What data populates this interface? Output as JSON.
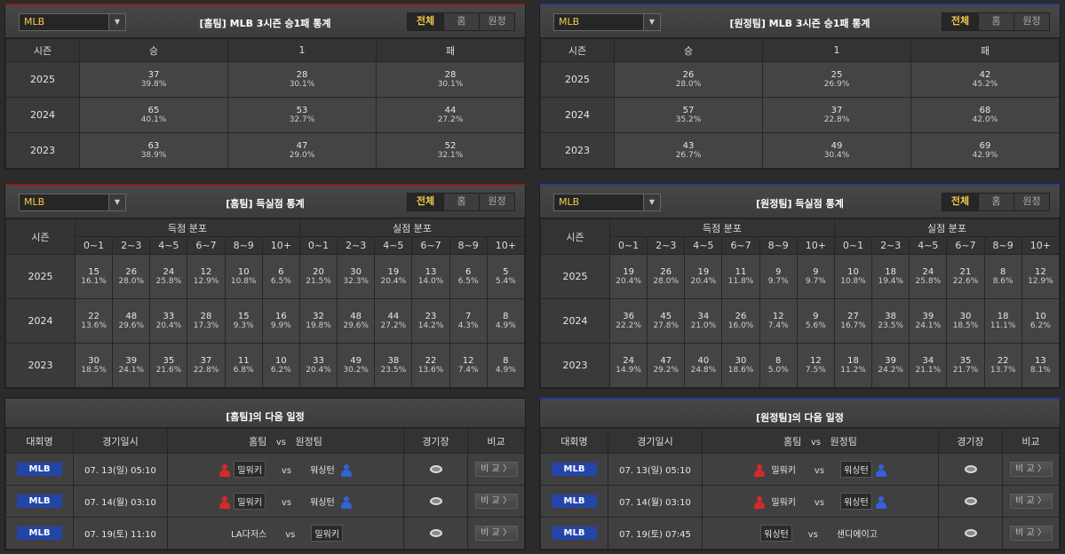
{
  "colors": {
    "home_accent": "#8b1e1e",
    "away_accent": "#23408a",
    "active_tab": "#f2c94c",
    "league_badge": "#2445a8"
  },
  "record": {
    "home": {
      "title": "[홈팀] MLB 3시즌 승1패 통계"
    },
    "away": {
      "title": "[원정팀] MLB 3시즌 승1패 통계"
    },
    "selector": "MLB",
    "tabs": [
      "전체",
      "홈",
      "원정"
    ],
    "headers": [
      "시즌",
      "승",
      "1",
      "패"
    ],
    "home_rows": [
      {
        "season": "2025",
        "cells": [
          [
            "37",
            "39.8%"
          ],
          [
            "28",
            "30.1%"
          ],
          [
            "28",
            "30.1%"
          ]
        ]
      },
      {
        "season": "2024",
        "cells": [
          [
            "65",
            "40.1%"
          ],
          [
            "53",
            "32.7%"
          ],
          [
            "44",
            "27.2%"
          ]
        ]
      },
      {
        "season": "2023",
        "cells": [
          [
            "63",
            "38.9%"
          ],
          [
            "47",
            "29.0%"
          ],
          [
            "52",
            "32.1%"
          ]
        ]
      }
    ],
    "away_rows": [
      {
        "season": "2025",
        "cells": [
          [
            "26",
            "28.0%"
          ],
          [
            "25",
            "26.9%"
          ],
          [
            "42",
            "45.2%"
          ]
        ]
      },
      {
        "season": "2024",
        "cells": [
          [
            "57",
            "35.2%"
          ],
          [
            "37",
            "22.8%"
          ],
          [
            "68",
            "42.0%"
          ]
        ]
      },
      {
        "season": "2023",
        "cells": [
          [
            "43",
            "26.7%"
          ],
          [
            "49",
            "30.4%"
          ],
          [
            "69",
            "42.9%"
          ]
        ]
      }
    ]
  },
  "scoring": {
    "home": {
      "title": "[홈팀] 득실점 통계"
    },
    "away": {
      "title": "[원정팀] 득실점 통계"
    },
    "season_header": "시즌",
    "scored_header": "득점 분포",
    "conceded_header": "실점 분포",
    "bins": [
      "0~1",
      "2~3",
      "4~5",
      "6~7",
      "8~9",
      "10+"
    ],
    "home_rows": [
      {
        "season": "2025",
        "cells": [
          [
            "15",
            "16.1%"
          ],
          [
            "26",
            "28.0%"
          ],
          [
            "24",
            "25.8%"
          ],
          [
            "12",
            "12.9%"
          ],
          [
            "10",
            "10.8%"
          ],
          [
            "6",
            "6.5%"
          ],
          [
            "20",
            "21.5%"
          ],
          [
            "30",
            "32.3%"
          ],
          [
            "19",
            "20.4%"
          ],
          [
            "13",
            "14.0%"
          ],
          [
            "6",
            "6.5%"
          ],
          [
            "5",
            "5.4%"
          ]
        ]
      },
      {
        "season": "2024",
        "cells": [
          [
            "22",
            "13.6%"
          ],
          [
            "48",
            "29.6%"
          ],
          [
            "33",
            "20.4%"
          ],
          [
            "28",
            "17.3%"
          ],
          [
            "15",
            "9.3%"
          ],
          [
            "16",
            "9.9%"
          ],
          [
            "32",
            "19.8%"
          ],
          [
            "48",
            "29.6%"
          ],
          [
            "44",
            "27.2%"
          ],
          [
            "23",
            "14.2%"
          ],
          [
            "7",
            "4.3%"
          ],
          [
            "8",
            "4.9%"
          ]
        ]
      },
      {
        "season": "2023",
        "cells": [
          [
            "30",
            "18.5%"
          ],
          [
            "39",
            "24.1%"
          ],
          [
            "35",
            "21.6%"
          ],
          [
            "37",
            "22.8%"
          ],
          [
            "11",
            "6.8%"
          ],
          [
            "10",
            "6.2%"
          ],
          [
            "33",
            "20.4%"
          ],
          [
            "49",
            "30.2%"
          ],
          [
            "38",
            "23.5%"
          ],
          [
            "22",
            "13.6%"
          ],
          [
            "12",
            "7.4%"
          ],
          [
            "8",
            "4.9%"
          ]
        ]
      }
    ],
    "away_rows": [
      {
        "season": "2025",
        "cells": [
          [
            "19",
            "20.4%"
          ],
          [
            "26",
            "28.0%"
          ],
          [
            "19",
            "20.4%"
          ],
          [
            "11",
            "11.8%"
          ],
          [
            "9",
            "9.7%"
          ],
          [
            "9",
            "9.7%"
          ],
          [
            "10",
            "10.8%"
          ],
          [
            "18",
            "19.4%"
          ],
          [
            "24",
            "25.8%"
          ],
          [
            "21",
            "22.6%"
          ],
          [
            "8",
            "8.6%"
          ],
          [
            "12",
            "12.9%"
          ]
        ]
      },
      {
        "season": "2024",
        "cells": [
          [
            "36",
            "22.2%"
          ],
          [
            "45",
            "27.8%"
          ],
          [
            "34",
            "21.0%"
          ],
          [
            "26",
            "16.0%"
          ],
          [
            "12",
            "7.4%"
          ],
          [
            "9",
            "5.6%"
          ],
          [
            "27",
            "16.7%"
          ],
          [
            "38",
            "23.5%"
          ],
          [
            "39",
            "24.1%"
          ],
          [
            "30",
            "18.5%"
          ],
          [
            "18",
            "11.1%"
          ],
          [
            "10",
            "6.2%"
          ]
        ]
      },
      {
        "season": "2023",
        "cells": [
          [
            "24",
            "14.9%"
          ],
          [
            "47",
            "29.2%"
          ],
          [
            "40",
            "24.8%"
          ],
          [
            "30",
            "18.6%"
          ],
          [
            "8",
            "5.0%"
          ],
          [
            "12",
            "7.5%"
          ],
          [
            "18",
            "11.2%"
          ],
          [
            "39",
            "24.2%"
          ],
          [
            "34",
            "21.1%"
          ],
          [
            "35",
            "21.7%"
          ],
          [
            "22",
            "13.7%"
          ],
          [
            "13",
            "8.1%"
          ]
        ]
      }
    ]
  },
  "schedule": {
    "home": {
      "title": "[홈팀]의 다음 일정"
    },
    "away": {
      "title": "[원정팀]의 다음 일정"
    },
    "headers": {
      "competition": "대회명",
      "datetime": "경기일시",
      "home": "홈팀",
      "vs": "vs",
      "away": "원정팀",
      "venue": "경기장",
      "compare": "비교"
    },
    "compare_label": "비 교 〉",
    "home_rows": [
      {
        "comp": "MLB",
        "date": "07. 13(일) 05:10",
        "home": "밀워키",
        "away": "워싱턴",
        "highlight": "home",
        "icons": true
      },
      {
        "comp": "MLB",
        "date": "07. 14(월) 03:10",
        "home": "밀워키",
        "away": "워싱턴",
        "highlight": "home",
        "icons": true
      },
      {
        "comp": "MLB",
        "date": "07. 19(토) 11:10",
        "home": "LA다저스",
        "away": "밀워키",
        "highlight": "away",
        "icons": false
      }
    ],
    "away_rows": [
      {
        "comp": "MLB",
        "date": "07. 13(일) 05:10",
        "home": "밀워키",
        "away": "워싱턴",
        "highlight": "away",
        "icons": true
      },
      {
        "comp": "MLB",
        "date": "07. 14(월) 03:10",
        "home": "밀워키",
        "away": "워싱턴",
        "highlight": "away",
        "icons": true
      },
      {
        "comp": "MLB",
        "date": "07. 19(토) 07:45",
        "home": "워싱턴",
        "away": "샌디에이고",
        "highlight": "home",
        "icons": false
      }
    ]
  }
}
